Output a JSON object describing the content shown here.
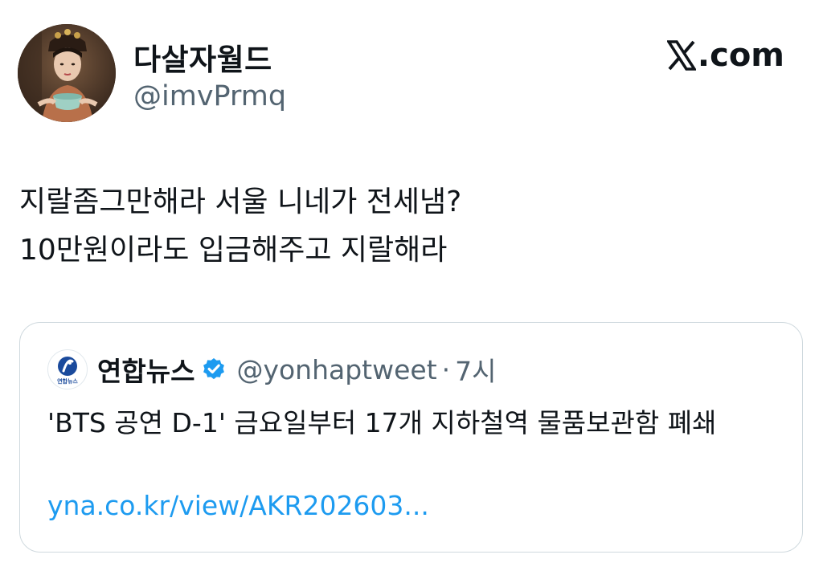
{
  "author": {
    "display_name": "다살자월드",
    "handle": "@imvPrmq"
  },
  "brand": {
    "label": ".com",
    "icon": "x-logo-icon"
  },
  "tweet": {
    "lines": [
      "지랄좀그만해라 서울 니네가 전세냄?",
      "10만원이라도 입금해주고 지랄해라"
    ]
  },
  "quoted_tweet": {
    "avatar_text": "연합뉴스",
    "display_name": "연합뉴스",
    "verified_icon": "verified-badge-icon",
    "handle": "@yonhaptweet",
    "separator": "·",
    "time": "7시",
    "body": "'BTS 공연 D-1' 금요일부터 17개 지하철역 물품보관함 폐쇄",
    "link": "yna.co.kr/view/AKR202603..."
  },
  "colors": {
    "text": "#0f1419",
    "secondary": "#536471",
    "link": "#1d9bf0",
    "verified": "#1d9bf0",
    "border": "#cfd9de"
  }
}
